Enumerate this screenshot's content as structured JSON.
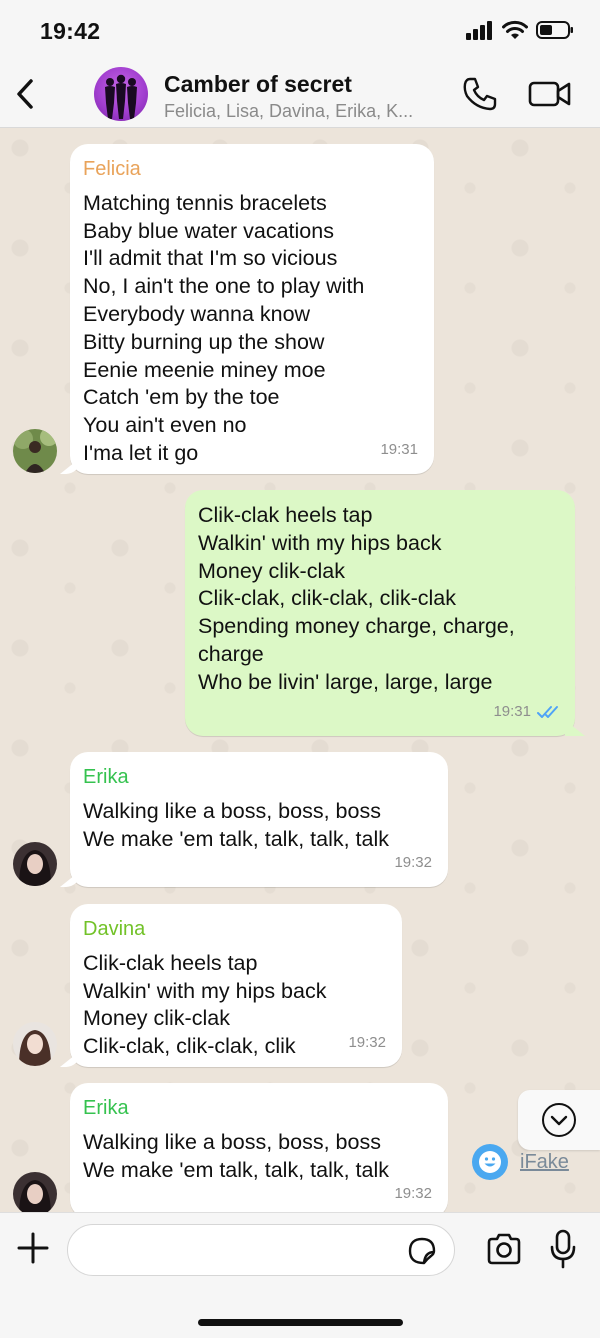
{
  "status_bar": {
    "time": "19:42"
  },
  "header": {
    "title": "Camber of secret",
    "subtitle": "Felicia, Lisa, Davina, Erika, K..."
  },
  "colors": {
    "chat_bg": "#ece4da",
    "incoming": "#ffffff",
    "outgoing": "#dcf8c6",
    "felicia": "#e9a35a",
    "erika": "#35c24f",
    "davina": "#72c228",
    "read_ticks": "#4fa3f7"
  },
  "messages": [
    {
      "direction": "incoming",
      "sender": "Felicia",
      "lines": [
        "Matching tennis bracelets",
        "Baby blue water vacations",
        "I'll admit that I'm so vicious",
        "No, I ain't the one to play with",
        "Everybody wanna know",
        "Bitty burning up the show",
        "Eenie meenie miney moe",
        "Catch 'em by the toe",
        "You ain't even no",
        "I'ma let it go"
      ],
      "time": "19:31"
    },
    {
      "direction": "outgoing",
      "lines": [
        "Clik-clak heels tap",
        "Walkin' with my hips back",
        "Money clik-clak",
        "Clik-clak, clik-clak, clik-clak",
        "Spending money charge, charge,",
        "charge",
        "Who be livin' large, large, large"
      ],
      "time": "19:31",
      "status": "read"
    },
    {
      "direction": "incoming",
      "sender": "Erika",
      "lines": [
        "Walking like a boss, boss, boss",
        "We make 'em talk, talk, talk, talk"
      ],
      "time": "19:32"
    },
    {
      "direction": "incoming",
      "sender": "Davina",
      "lines": [
        "Clik-clak heels tap",
        "Walkin' with my hips back",
        "Money clik-clak",
        "Clik-clak, clik-clak, clik"
      ],
      "time": "19:32"
    },
    {
      "direction": "incoming",
      "sender": "Erika",
      "lines": [
        "Walking like a boss, boss, boss",
        "We make 'em talk, talk, talk, talk"
      ],
      "time": "19:32"
    }
  ],
  "watermark": {
    "text": "iFake"
  },
  "input": {
    "value": "",
    "placeholder": ""
  }
}
